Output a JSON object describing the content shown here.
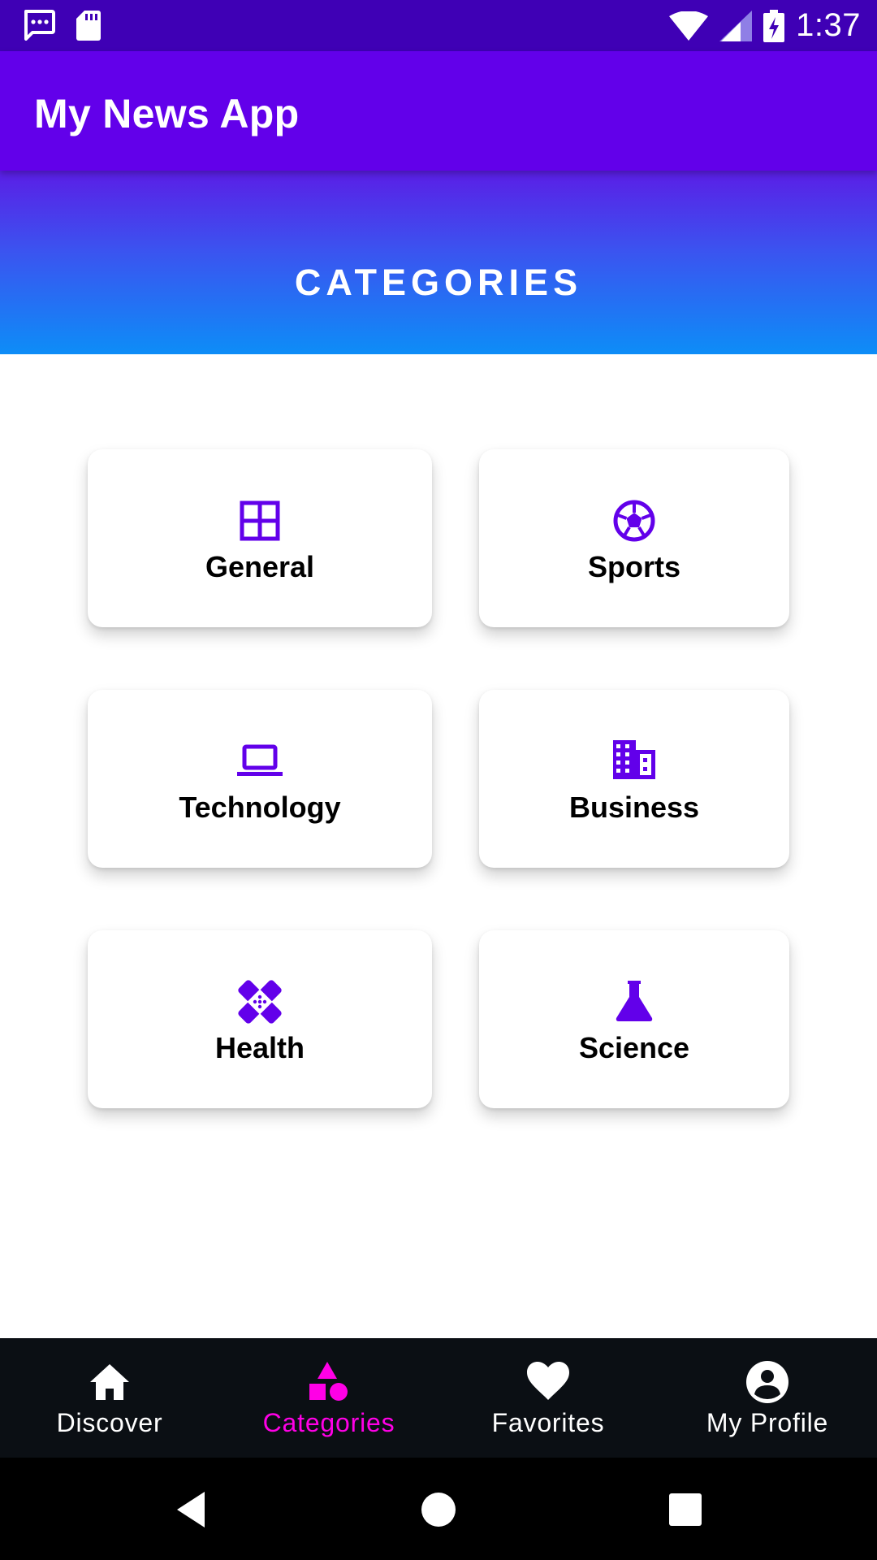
{
  "status_bar": {
    "time": "1:37",
    "icons": [
      "message-icon",
      "sd-card-icon",
      "wifi-icon",
      "signal-icon",
      "battery-charging-icon"
    ]
  },
  "app_bar": {
    "title": "My News App"
  },
  "banner": {
    "title": "CATEGORIES"
  },
  "categories": [
    {
      "label": "General",
      "icon": "grid-icon"
    },
    {
      "label": "Sports",
      "icon": "soccer-ball-icon"
    },
    {
      "label": "Technology",
      "icon": "laptop-icon"
    },
    {
      "label": "Business",
      "icon": "building-icon"
    },
    {
      "label": "Health",
      "icon": "bandage-icon"
    },
    {
      "label": "Science",
      "icon": "flask-icon"
    }
  ],
  "bottom_nav": {
    "items": [
      {
        "label": "Discover",
        "icon": "home-icon",
        "active": false
      },
      {
        "label": "Categories",
        "icon": "shapes-icon",
        "active": true
      },
      {
        "label": "Favorites",
        "icon": "heart-icon",
        "active": false
      },
      {
        "label": "My Profile",
        "icon": "account-circle-icon",
        "active": false
      }
    ]
  },
  "system_nav": {
    "buttons": [
      "back-icon",
      "home-circle-icon",
      "recents-icon"
    ]
  },
  "colors": {
    "status_bar": "#3f00b5",
    "app_bar": "#6200ea",
    "icon_accent": "#6200ea",
    "active_nav": "#ff00e6",
    "nav_background": "#0b0f14"
  }
}
